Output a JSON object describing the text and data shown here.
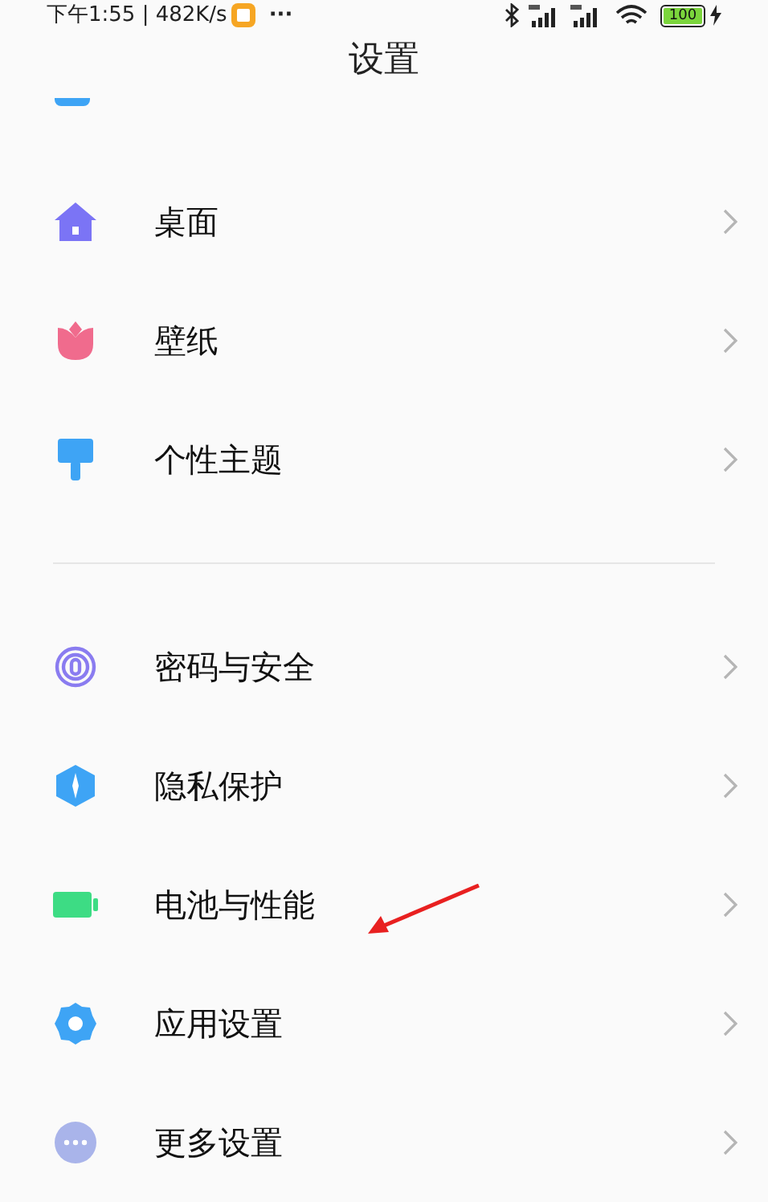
{
  "status_bar": {
    "time": "下午1:55 | 482K/s",
    "more": "···",
    "battery": "100"
  },
  "header": {
    "title": "设置"
  },
  "sections": [
    {
      "items": [
        {
          "kind": "cut"
        },
        {
          "kind": "home",
          "label": "桌面"
        },
        {
          "kind": "tulip",
          "label": "壁纸"
        },
        {
          "kind": "brush",
          "label": "个性主题"
        }
      ]
    },
    {
      "items": [
        {
          "kind": "fingerprint",
          "label": "密码与安全"
        },
        {
          "kind": "shield",
          "label": "隐私保护"
        },
        {
          "kind": "battery",
          "label": "电池与性能"
        },
        {
          "kind": "gear",
          "label": "应用设置"
        },
        {
          "kind": "more",
          "label": "更多设置"
        }
      ]
    }
  ]
}
